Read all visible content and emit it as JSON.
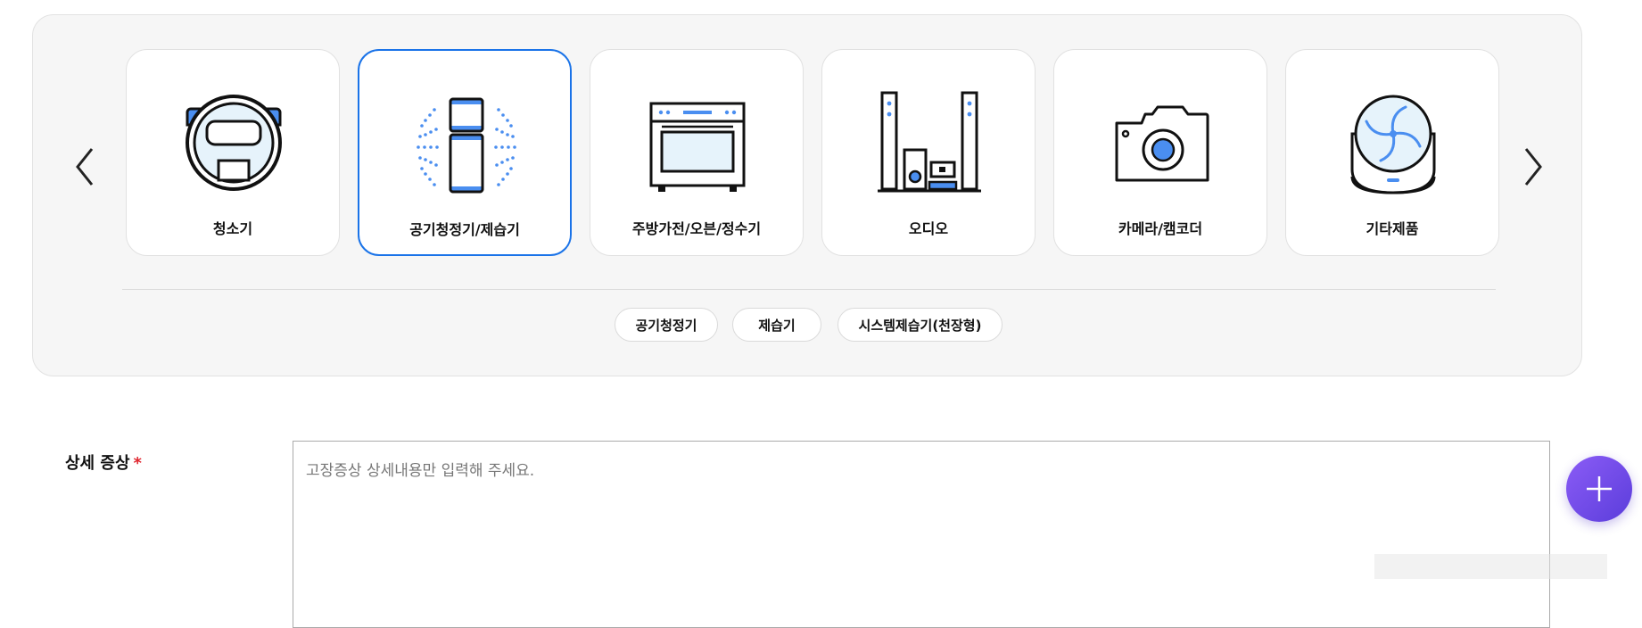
{
  "categories": [
    {
      "label": "청소기",
      "icon": "robot-vacuum-icon",
      "active": false
    },
    {
      "label": "공기청정기/제습기",
      "icon": "air-purifier-icon",
      "active": true
    },
    {
      "label": "주방가전/오븐/정수기",
      "icon": "oven-icon",
      "active": false
    },
    {
      "label": "오디오",
      "icon": "audio-speaker-icon",
      "active": false
    },
    {
      "label": "카메라/캠코더",
      "icon": "camera-icon",
      "active": false
    },
    {
      "label": "기타제품",
      "icon": "fan-icon",
      "active": false
    }
  ],
  "subcategories": [
    "공기청정기",
    "제습기",
    "시스템제습기(천장형)"
  ],
  "form": {
    "symptom_label": "상세 증상",
    "required_mark": "*",
    "symptom_placeholder": "고장증상 상세내용만 입력해 주세요.",
    "symptom_value": ""
  },
  "colors": {
    "accent": "#1a73e8",
    "icon_blue": "#4a8ef0",
    "icon_light": "#e6f3fb",
    "fab": "#7b4fe8",
    "required": "#e0262f"
  }
}
